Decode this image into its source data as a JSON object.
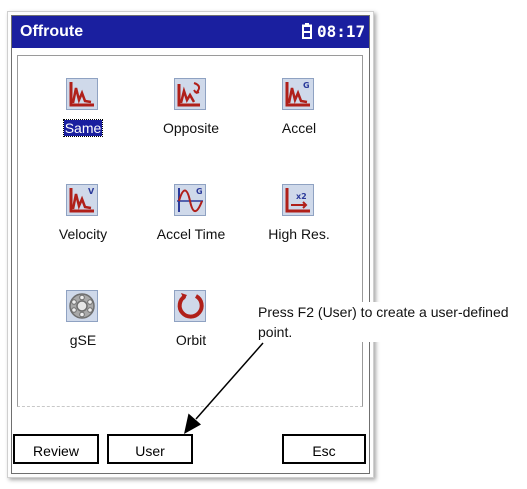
{
  "titlebar": {
    "app_title": "Offroute",
    "clock": "08:17",
    "battery_icon": "battery-icon"
  },
  "tiles": [
    {
      "label": "Same",
      "icon": "chart-spectrum-icon",
      "selected": true
    },
    {
      "label": "Opposite",
      "icon": "chart-opposite-icon",
      "selected": false
    },
    {
      "label": "Accel",
      "icon": "chart-accel-icon",
      "selected": false
    },
    {
      "label": "Velocity",
      "icon": "chart-velocity-icon",
      "selected": false
    },
    {
      "label": "Accel Time",
      "icon": "waveform-icon",
      "selected": false
    },
    {
      "label": "High Res.",
      "icon": "high-res-icon",
      "selected": false
    },
    {
      "label": "gSE",
      "icon": "bearing-icon",
      "selected": false
    },
    {
      "label": "Orbit",
      "icon": "orbit-icon",
      "selected": false
    }
  ],
  "softkeys": {
    "review": "Review",
    "user": "User",
    "esc": "Esc"
  },
  "callout": {
    "text": "Press F2 (User) to create a user-defined point."
  },
  "colors": {
    "titlebar": "#1a1f9f",
    "icon_red": "#b0201a",
    "icon_blue": "#2b3a9a",
    "icon_bg": "#cfd9ea"
  }
}
